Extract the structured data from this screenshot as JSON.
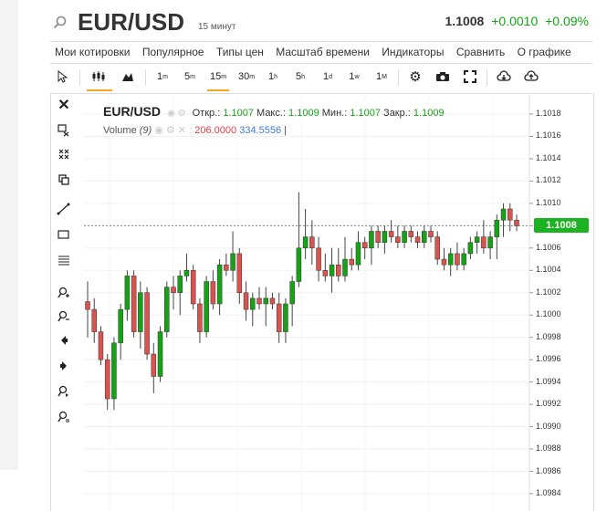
{
  "header": {
    "symbol": "EUR/USD",
    "interval": "15 минут",
    "last_price": "1.1008",
    "change": "+0.0010",
    "change_pct": "+0.09%"
  },
  "menu": [
    "Мои котировки",
    "Популярное",
    "Типы цен",
    "Масштаб времени",
    "Индикаторы",
    "Сравнить",
    "О графике"
  ],
  "timeframes": [
    {
      "base": "1",
      "sup": "m"
    },
    {
      "base": "5",
      "sup": "m"
    },
    {
      "base": "15",
      "sup": "m"
    },
    {
      "base": "30",
      "sup": "m"
    },
    {
      "base": "1",
      "sup": "h"
    },
    {
      "base": "5",
      "sup": "h"
    },
    {
      "base": "1",
      "sup": "d"
    },
    {
      "base": "1",
      "sup": "w"
    },
    {
      "base": "1",
      "sup": "M"
    }
  ],
  "selected_timeframe": "15m",
  "legend": {
    "symbol": "EUR/USD",
    "open_label": "Откр.:",
    "open": "1.1007",
    "high_label": "Макс.:",
    "high": "1.1009",
    "low_label": "Мин.:",
    "low": "1.1007",
    "close_label": "Закр.:",
    "close": "1.1009",
    "volume_label": "Volume",
    "volume_param": "(9)",
    "volume_value1": "206.0000",
    "volume_value2": "334.5556"
  },
  "price_tag": "1.1008",
  "colors": {
    "up": "#15a215",
    "down": "#d9534f",
    "accent": "#f5a623",
    "price_tag": "#1bb321"
  },
  "chart_data": {
    "type": "candlestick",
    "y_range": [
      1.0984,
      1.1018
    ],
    "y_ticks": [
      "1.1018",
      "1.1016",
      "1.1014",
      "1.1012",
      "1.1010",
      "1.1008",
      "1.1006",
      "1.1004",
      "1.1002",
      "1.1000",
      "1.0998",
      "1.0996",
      "1.0994",
      "1.0992",
      "1.0990",
      "1.0988",
      "1.0986",
      "1.0984"
    ],
    "current_price": 1.1008,
    "candles": [
      [
        1.10012,
        1.1003,
        1.0998,
        1.10005
      ],
      [
        1.10005,
        1.10015,
        1.09975,
        1.09985
      ],
      [
        1.09985,
        1.0999,
        1.09955,
        1.0996
      ],
      [
        1.0996,
        1.09965,
        1.09915,
        1.09925
      ],
      [
        1.09925,
        1.0998,
        1.09915,
        1.09975
      ],
      [
        1.09975,
        1.1001,
        1.0996,
        1.10005
      ],
      [
        1.10005,
        1.1004,
        1.09995,
        1.10035
      ],
      [
        1.10035,
        1.1004,
        1.0998,
        1.09985
      ],
      [
        1.09985,
        1.1003,
        1.0997,
        1.1002
      ],
      [
        1.1002,
        1.10025,
        1.0996,
        1.09965
      ],
      [
        1.09965,
        1.09975,
        1.0993,
        1.09945
      ],
      [
        1.09945,
        1.0999,
        1.0994,
        1.09985
      ],
      [
        1.09985,
        1.1003,
        1.0998,
        1.10025
      ],
      [
        1.10025,
        1.10035,
        1.10005,
        1.1002
      ],
      [
        1.1002,
        1.1004,
        1.1,
        1.10035
      ],
      [
        1.10035,
        1.10055,
        1.1003,
        1.1004
      ],
      [
        1.1004,
        1.10045,
        1.10005,
        1.1001
      ],
      [
        1.1001,
        1.10015,
        1.09975,
        1.09985
      ],
      [
        1.09985,
        1.10035,
        1.0998,
        1.1003
      ],
      [
        1.1003,
        1.1004,
        1.10005,
        1.1001
      ],
      [
        1.1001,
        1.1005,
        1.1,
        1.10045
      ],
      [
        1.10045,
        1.10055,
        1.10035,
        1.1004
      ],
      [
        1.1004,
        1.10075,
        1.1003,
        1.10055
      ],
      [
        1.10055,
        1.1006,
        1.1001,
        1.1002
      ],
      [
        1.1002,
        1.1003,
        1.09995,
        1.10005
      ],
      [
        1.10005,
        1.1002,
        1.0999,
        1.10015
      ],
      [
        1.10015,
        1.10025,
        1.10005,
        1.1001
      ],
      [
        1.1001,
        1.10025,
        1.0999,
        1.10015
      ],
      [
        1.10015,
        1.1002,
        1.10005,
        1.1001
      ],
      [
        1.1001,
        1.1002,
        1.09975,
        1.09985
      ],
      [
        1.09985,
        1.10015,
        1.09975,
        1.1001
      ],
      [
        1.1001,
        1.10035,
        1.0999,
        1.1003
      ],
      [
        1.1003,
        1.1011,
        1.10025,
        1.1006
      ],
      [
        1.1006,
        1.10095,
        1.1005,
        1.1007
      ],
      [
        1.1007,
        1.10085,
        1.10045,
        1.1006
      ],
      [
        1.1006,
        1.1007,
        1.1003,
        1.1004
      ],
      [
        1.1004,
        1.10055,
        1.1003,
        1.10035
      ],
      [
        1.10035,
        1.1006,
        1.1002,
        1.10045
      ],
      [
        1.10045,
        1.1006,
        1.1003,
        1.10035
      ],
      [
        1.10035,
        1.1007,
        1.1003,
        1.1005
      ],
      [
        1.1005,
        1.1006,
        1.1004,
        1.10045
      ],
      [
        1.10045,
        1.10075,
        1.1004,
        1.10065
      ],
      [
        1.10065,
        1.1007,
        1.1005,
        1.1006
      ],
      [
        1.1006,
        1.1008,
        1.10045,
        1.10075
      ],
      [
        1.10075,
        1.1008,
        1.1006,
        1.10065
      ],
      [
        1.10065,
        1.1008,
        1.10055,
        1.10075
      ],
      [
        1.10075,
        1.10085,
        1.10065,
        1.1007
      ],
      [
        1.1007,
        1.1008,
        1.1006,
        1.10065
      ],
      [
        1.10065,
        1.1008,
        1.1006,
        1.10075
      ],
      [
        1.10075,
        1.1008,
        1.10065,
        1.1007
      ],
      [
        1.1007,
        1.10075,
        1.1006,
        1.10065
      ],
      [
        1.10065,
        1.1008,
        1.1006,
        1.10075
      ],
      [
        1.10075,
        1.1008,
        1.10065,
        1.1007
      ],
      [
        1.1007,
        1.10075,
        1.10045,
        1.1005
      ],
      [
        1.1005,
        1.1006,
        1.1004,
        1.10045
      ],
      [
        1.10045,
        1.1006,
        1.10035,
        1.10055
      ],
      [
        1.10055,
        1.10065,
        1.1004,
        1.10045
      ],
      [
        1.10045,
        1.1006,
        1.1004,
        1.10055
      ],
      [
        1.10055,
        1.1007,
        1.1005,
        1.10065
      ],
      [
        1.10065,
        1.10075,
        1.10055,
        1.1007
      ],
      [
        1.1007,
        1.10085,
        1.10055,
        1.1006
      ],
      [
        1.1006,
        1.10075,
        1.1005,
        1.1007
      ],
      [
        1.1007,
        1.1009,
        1.1005,
        1.10085
      ],
      [
        1.10085,
        1.101,
        1.1007,
        1.10095
      ],
      [
        1.10095,
        1.101,
        1.10075,
        1.10085
      ],
      [
        1.10085,
        1.1009,
        1.10075,
        1.1008
      ]
    ]
  }
}
